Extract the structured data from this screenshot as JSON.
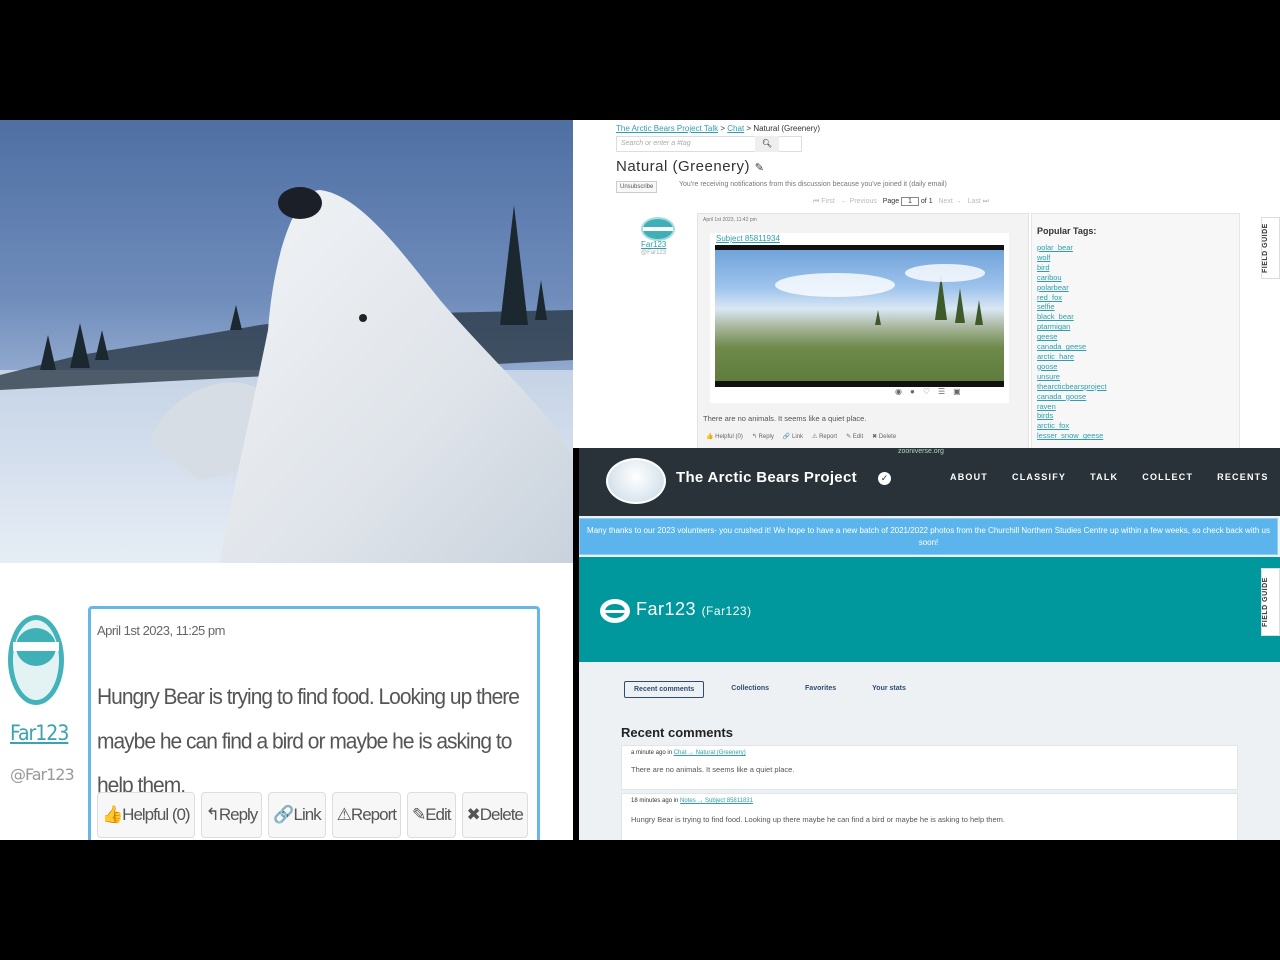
{
  "zoom_comment": {
    "username": "Far123",
    "handle": "@Far123",
    "date": "April 1st 2023, 11:25 pm",
    "body": "Hungry Bear is trying to find food. Looking up there maybe he can find a bird or maybe he is asking to help them.",
    "actions": [
      "Helpful (0)",
      "Reply",
      "Link",
      "Report",
      "Edit",
      "Delete"
    ]
  },
  "talk": {
    "breadcrumb_talk": "The Arctic Bears Project Talk",
    "breadcrumb_sep1": ">",
    "breadcrumb_chat": "Chat",
    "breadcrumb_sep2": ">",
    "breadcrumb_current": "Natural (Greenery)",
    "search_placeholder": "Search or enter a #tag",
    "title": "Natural (Greenery)",
    "unsubscribe": "Unsubscribe",
    "notice": "You're receiving notifications from this discussion because you've joined it (daily email)",
    "pager": {
      "first": "⏮ First",
      "previous": "← Previous",
      "page_label": "Page",
      "page_value": "1",
      "of_label": "of 1",
      "next": "Next →",
      "last": "Last ⏭"
    },
    "comment": {
      "username": "Far123",
      "handle": "@Far123",
      "date": "April 1st 2023, 11:42 pm",
      "subject_link": "Subject 85811934",
      "text": "There are no animals. It seems like a quiet place.",
      "actions": [
        "Helpful (0)",
        "Reply",
        "Link",
        "Report",
        "Edit",
        "Delete"
      ]
    },
    "popular_tags_heading": "Popular Tags:",
    "popular_tags": [
      "polar_bear",
      "wolf",
      "bird",
      "caribou",
      "polarbear",
      "red_fox",
      "selfie",
      "black_bear",
      "ptarmigan",
      "geese",
      "canada_geese",
      "arctic_hare",
      "goose",
      "unsure",
      "thearcticbearsproject",
      "canada_goose",
      "raven",
      "birds",
      "arctic_fox",
      "lesser_snow_geese"
    ],
    "field_guide": "FIELD GUIDE"
  },
  "profile": {
    "url": "zooniverse.org",
    "project_name": "The Arctic Bears Project",
    "nav": [
      "ABOUT",
      "CLASSIFY",
      "TALK",
      "COLLECT",
      "RECENTS"
    ],
    "banner": "Many thanks to our 2023 volunteers- you crushed it! We hope to have a new batch of 2021/2022 photos from the Churchill Northern Studies Centre up within a few weeks, so check back with us soon!",
    "display_name": "Far123",
    "login": "(Far123)",
    "tabs": [
      "Recent comments",
      "Collections",
      "Favorites",
      "Your stats"
    ],
    "section_heading": "Recent comments",
    "comments": [
      {
        "time": "a minute ago in",
        "link": "Chat → Natural (Greenery)",
        "text": "There are no animals. It seems like a quiet place."
      },
      {
        "time": "18 minutes ago in",
        "link": "Notes → Subject 85811831",
        "text": "Hungry Bear is trying to find food. Looking up there maybe he can find a bird or maybe he is asking to help them."
      }
    ],
    "field_guide": "FIELD GUIDE"
  },
  "colors": {
    "teal": "#00979d",
    "nav_bg": "#283238",
    "banner": "#5bb5ec",
    "link": "#2d9fae"
  }
}
